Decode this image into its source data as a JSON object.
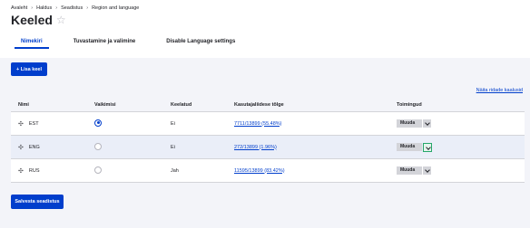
{
  "breadcrumb": [
    "Avaleht",
    "Haldus",
    "Seadistus",
    "Region and language"
  ],
  "page_title": "Keeled",
  "tabs": [
    {
      "label": "Nimekiri",
      "active": true
    },
    {
      "label": "Tuvastamine ja valimine",
      "active": false
    },
    {
      "label": "Disable Language settings",
      "active": false
    }
  ],
  "add_button": "+ Lisa keel",
  "show_weights": "Näita ridade kaalusid",
  "table": {
    "headers": [
      "Nimi",
      "Vaikimisi",
      "Keelatud",
      "Kasutajaliidese tõlge",
      "Toimingud"
    ],
    "rows": [
      {
        "name": "EST",
        "default": true,
        "disabled": "Ei",
        "translation": "7711/13899 (55.48%)",
        "op": "Muuda"
      },
      {
        "name": "ENG",
        "default": false,
        "disabled": "Ei",
        "translation": "272/13899 (1.96%)",
        "op": "Muuda"
      },
      {
        "name": "RUS",
        "default": false,
        "disabled": "Jah",
        "translation": "11595/13899 (83.42%)",
        "op": "Muuda"
      }
    ]
  },
  "save_button": "Salvesta seadistus",
  "colors": {
    "accent": "#003ecc",
    "focus": "#26a769"
  }
}
